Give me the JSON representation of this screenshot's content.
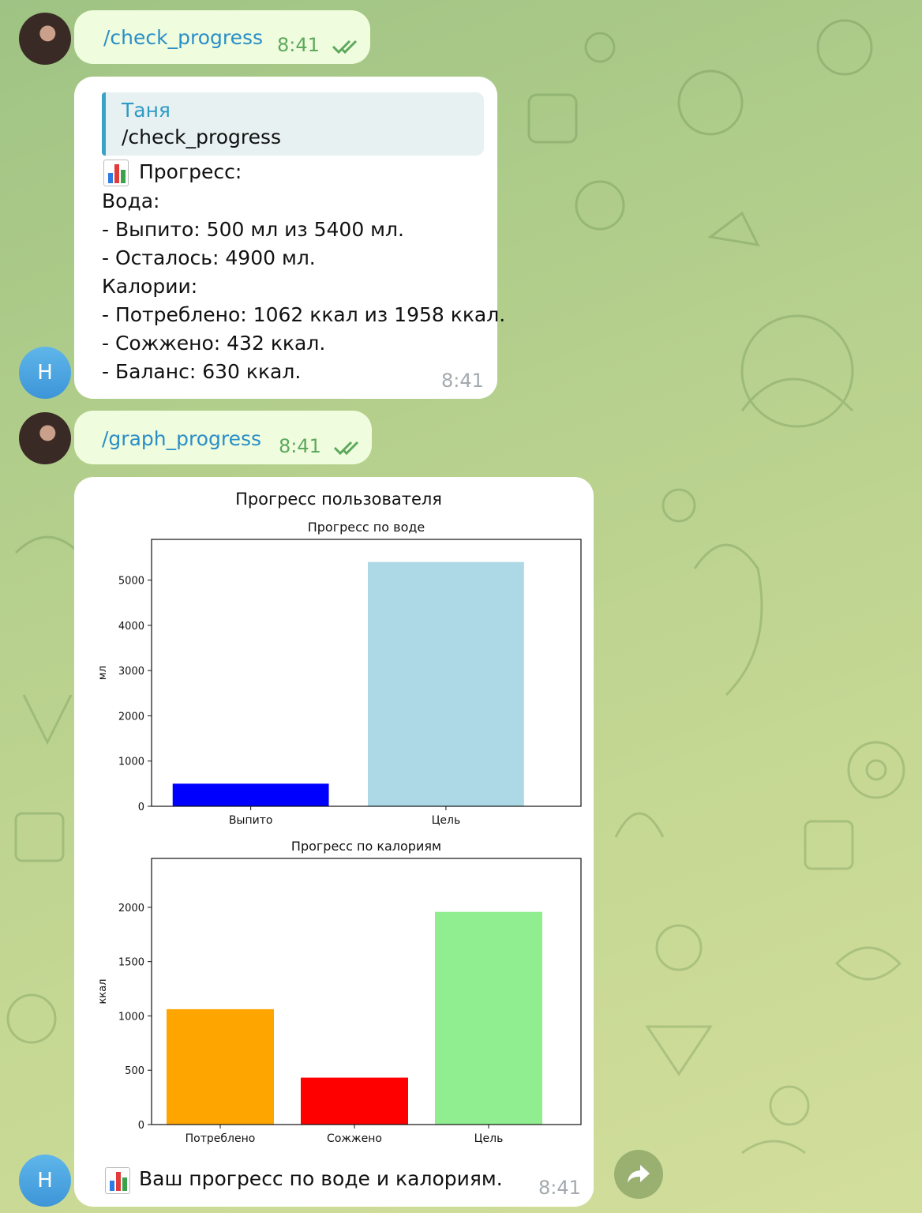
{
  "messages": {
    "cmd1": {
      "text": "/check_progress",
      "time": "8:41"
    },
    "reply": {
      "quote_name": "Таня",
      "quote_text": "/check_progress",
      "lines": [
        "Прогресс:",
        "Вода:",
        "- Выпито: 500 мл из 5400 мл.",
        "- Осталось: 4900 мл.",
        "Калории:",
        "- Потреблено: 1062 ккал из 1958 ккал.",
        "- Сожжено: 432 ккал.",
        "- Баланс: 630 ккал."
      ],
      "time": "8:41"
    },
    "cmd2": {
      "text": "/graph_progress",
      "time": "8:41"
    },
    "graph": {
      "caption": "Ваш прогресс по воде и калориям.",
      "time": "8:41"
    }
  },
  "bot_avatar_letter": "Н",
  "icons": {
    "sent_status": "double-check-icon",
    "forward": "forward-arrow-icon",
    "emoji": "bar-chart-emoji-icon"
  },
  "colors": {
    "outgoing_bubble": "#effdde",
    "incoming_bubble": "#ffffff",
    "link": "#2a8ec7"
  },
  "chart_data": {
    "suptitle": "Прогресс пользователя",
    "charts": [
      {
        "type": "bar",
        "title": "Прогресс по воде",
        "ylabel": "мл",
        "categories": [
          "Выпито",
          "Цель"
        ],
        "values": [
          500,
          5400
        ],
        "colors": [
          "#0000ff",
          "#add8e6"
        ],
        "ylim": [
          0,
          5900
        ],
        "yticks": [
          0,
          1000,
          2000,
          3000,
          4000,
          5000
        ]
      },
      {
        "type": "bar",
        "title": "Прогресс по калориям",
        "ylabel": "ккал",
        "categories": [
          "Потреблено",
          "Сожжено",
          "Цель"
        ],
        "values": [
          1062,
          432,
          1958
        ],
        "colors": [
          "#ffa500",
          "#ff0000",
          "#90ee90"
        ],
        "ylim": [
          0,
          2450
        ],
        "yticks": [
          0,
          500,
          1000,
          1500,
          2000
        ]
      }
    ]
  }
}
